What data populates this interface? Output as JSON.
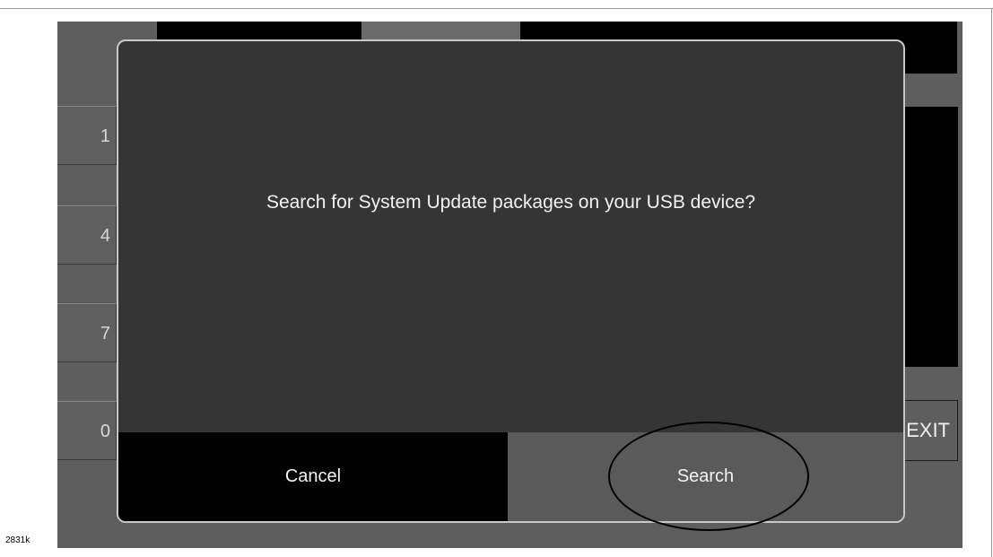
{
  "keypad": {
    "keys": [
      "1",
      "4",
      "7",
      "0"
    ]
  },
  "exit_button": {
    "label": "EXIT"
  },
  "dialog": {
    "message": "Search for System Update packages on your USB device?",
    "cancel_label": "Cancel",
    "search_label": "Search"
  },
  "figure_code": "2831k",
  "colors": {
    "screen_bg": "#5e5e5e",
    "dialog_bg": "#353535",
    "cancel_bg": "#000000",
    "search_bg": "#5a5a5a"
  }
}
